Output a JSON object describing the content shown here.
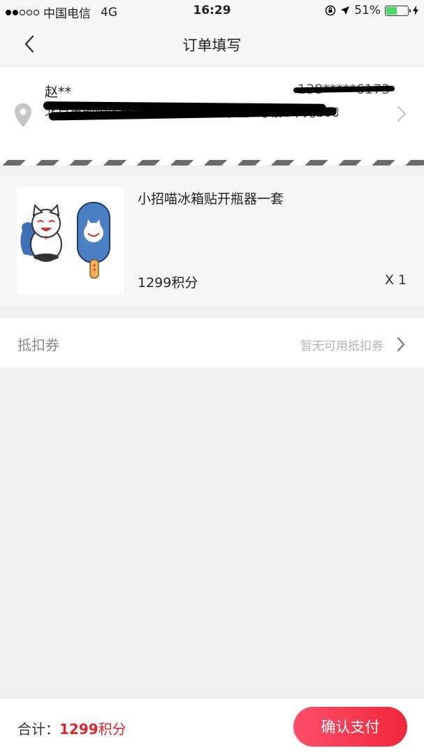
{
  "status_bar": {
    "carrier": "中国电信",
    "network": "4G",
    "time": "16:29",
    "battery": "51%",
    "battery_fill": 0.51
  },
  "nav": {
    "title": "订单填写",
    "back_icon": "chevron-left-icon"
  },
  "address": {
    "name": "赵**",
    "phone": "138*****6173",
    "detail": "北京市朝阳区建国路88号现代城小区3号楼2单元1001室",
    "icon": "location-pin-icon"
  },
  "product": {
    "name": "小招喵冰箱贴开瓶器一套",
    "price": "1299积分",
    "quantity": "X 1"
  },
  "coupon": {
    "label": "抵扣券",
    "value": "暂无可用抵扣券"
  },
  "footer": {
    "total_label": "合计：",
    "total_amount": "1299",
    "total_unit": "积分",
    "pay_label": "确认支付"
  },
  "colors": {
    "accent": "#e0262c",
    "pay_button_start": "#ff4f6a",
    "pay_button_end": "#f0273b"
  }
}
